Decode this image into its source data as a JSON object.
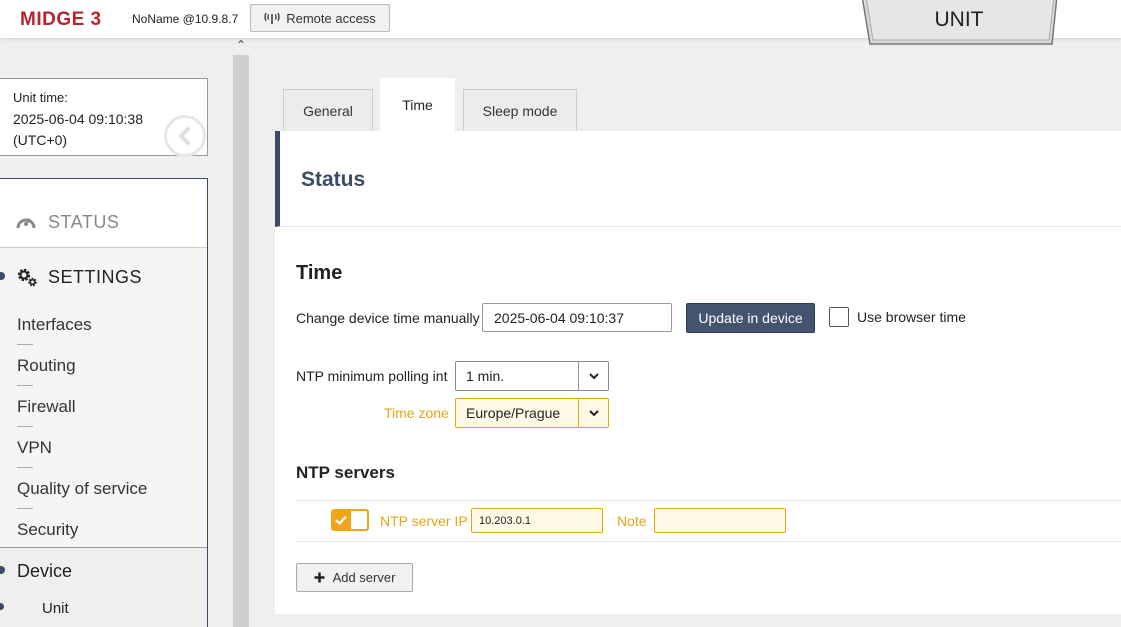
{
  "header": {
    "logo": "MIDGE 3",
    "hostname": "NoName @10.9.8.7",
    "remote_access_label": "Remote access",
    "unit_tab_label": "UNIT"
  },
  "sidebar": {
    "unit_time_label": "Unit time:",
    "unit_time_value": "2025-06-04 09:10:38 (UTC+0)",
    "status_label": "STATUS",
    "settings_label": "SETTINGS",
    "items": [
      {
        "label": "Interfaces"
      },
      {
        "label": "Routing"
      },
      {
        "label": "Firewall"
      },
      {
        "label": "VPN"
      },
      {
        "label": "Quality of service"
      },
      {
        "label": "Security"
      }
    ],
    "device_label": "Device",
    "unit_label": "Unit"
  },
  "tabs": [
    {
      "label": "General",
      "active": false
    },
    {
      "label": "Time",
      "active": true
    },
    {
      "label": "Sleep mode",
      "active": false
    }
  ],
  "main": {
    "status_title": "Status",
    "time_title": "Time",
    "change_time_label": "Change device time manually",
    "change_time_value": "2025-06-04 09:10:37",
    "update_button": "Update in device",
    "browser_time_label": "Use browser time",
    "browser_time_checked": false,
    "ntp_polling_label": "NTP minimum polling int",
    "ntp_polling_value": "1 min.",
    "timezone_label": "Time zone",
    "timezone_value": "Europe/Prague",
    "ntp_servers_title": "NTP servers",
    "ntp_servers": [
      {
        "enabled": true,
        "ip_label": "NTP server IP",
        "ip_value": "10.203.0.1",
        "note_label": "Note",
        "note_value": ""
      }
    ],
    "add_server_label": "Add server"
  },
  "colors": {
    "logo": "#b3262d",
    "accent_dark": "#3d4a66",
    "highlight": "#e5a417",
    "toggle_on": "#f0a51a"
  }
}
